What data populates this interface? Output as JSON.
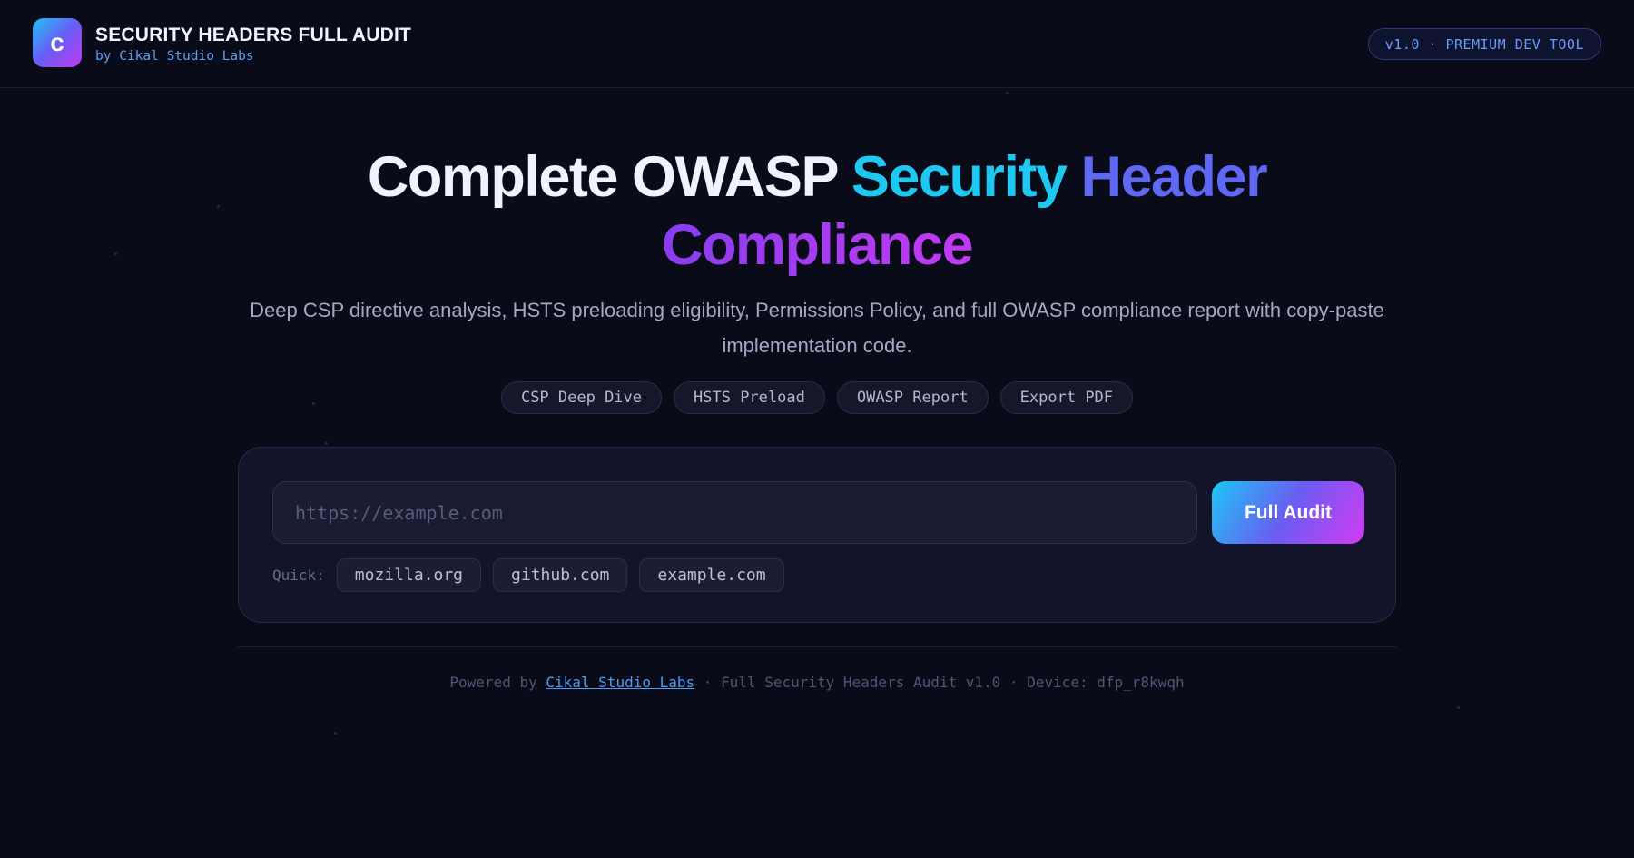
{
  "header": {
    "logo_letter": "c",
    "title": "SECURITY HEADERS FULL AUDIT",
    "subtitle": "by Cikal Studio Labs",
    "version_badge": "v1.0 · PREMIUM DEV TOOL"
  },
  "hero": {
    "title_part1": "Complete OWASP ",
    "title_part2": "Security",
    "title_part3": " Header",
    "title_part4": "Compliance",
    "description": "Deep CSP directive analysis, HSTS preloading eligibility, Permissions Policy, and full OWASP compliance report with copy-paste implementation code.",
    "chips": [
      "CSP Deep Dive",
      "HSTS Preload",
      "OWASP Report",
      "Export PDF"
    ]
  },
  "audit": {
    "url_value": "",
    "url_placeholder": "https://example.com",
    "button_label": "Full Audit",
    "quick_label": "Quick:",
    "quick_items": [
      "mozilla.org",
      "github.com",
      "example.com"
    ]
  },
  "footer": {
    "prefix": "Powered by ",
    "link_text": "Cikal Studio Labs",
    "suffix": " · Full Security Headers Audit v1.0 · Device: dfp_r8kwqh"
  },
  "colors": {
    "background": "#0a0b18",
    "accent_cyan": "#1fc8f0",
    "accent_indigo": "#5e68f3",
    "accent_purple": "#c23af3",
    "link_blue": "#4d9bf3"
  }
}
